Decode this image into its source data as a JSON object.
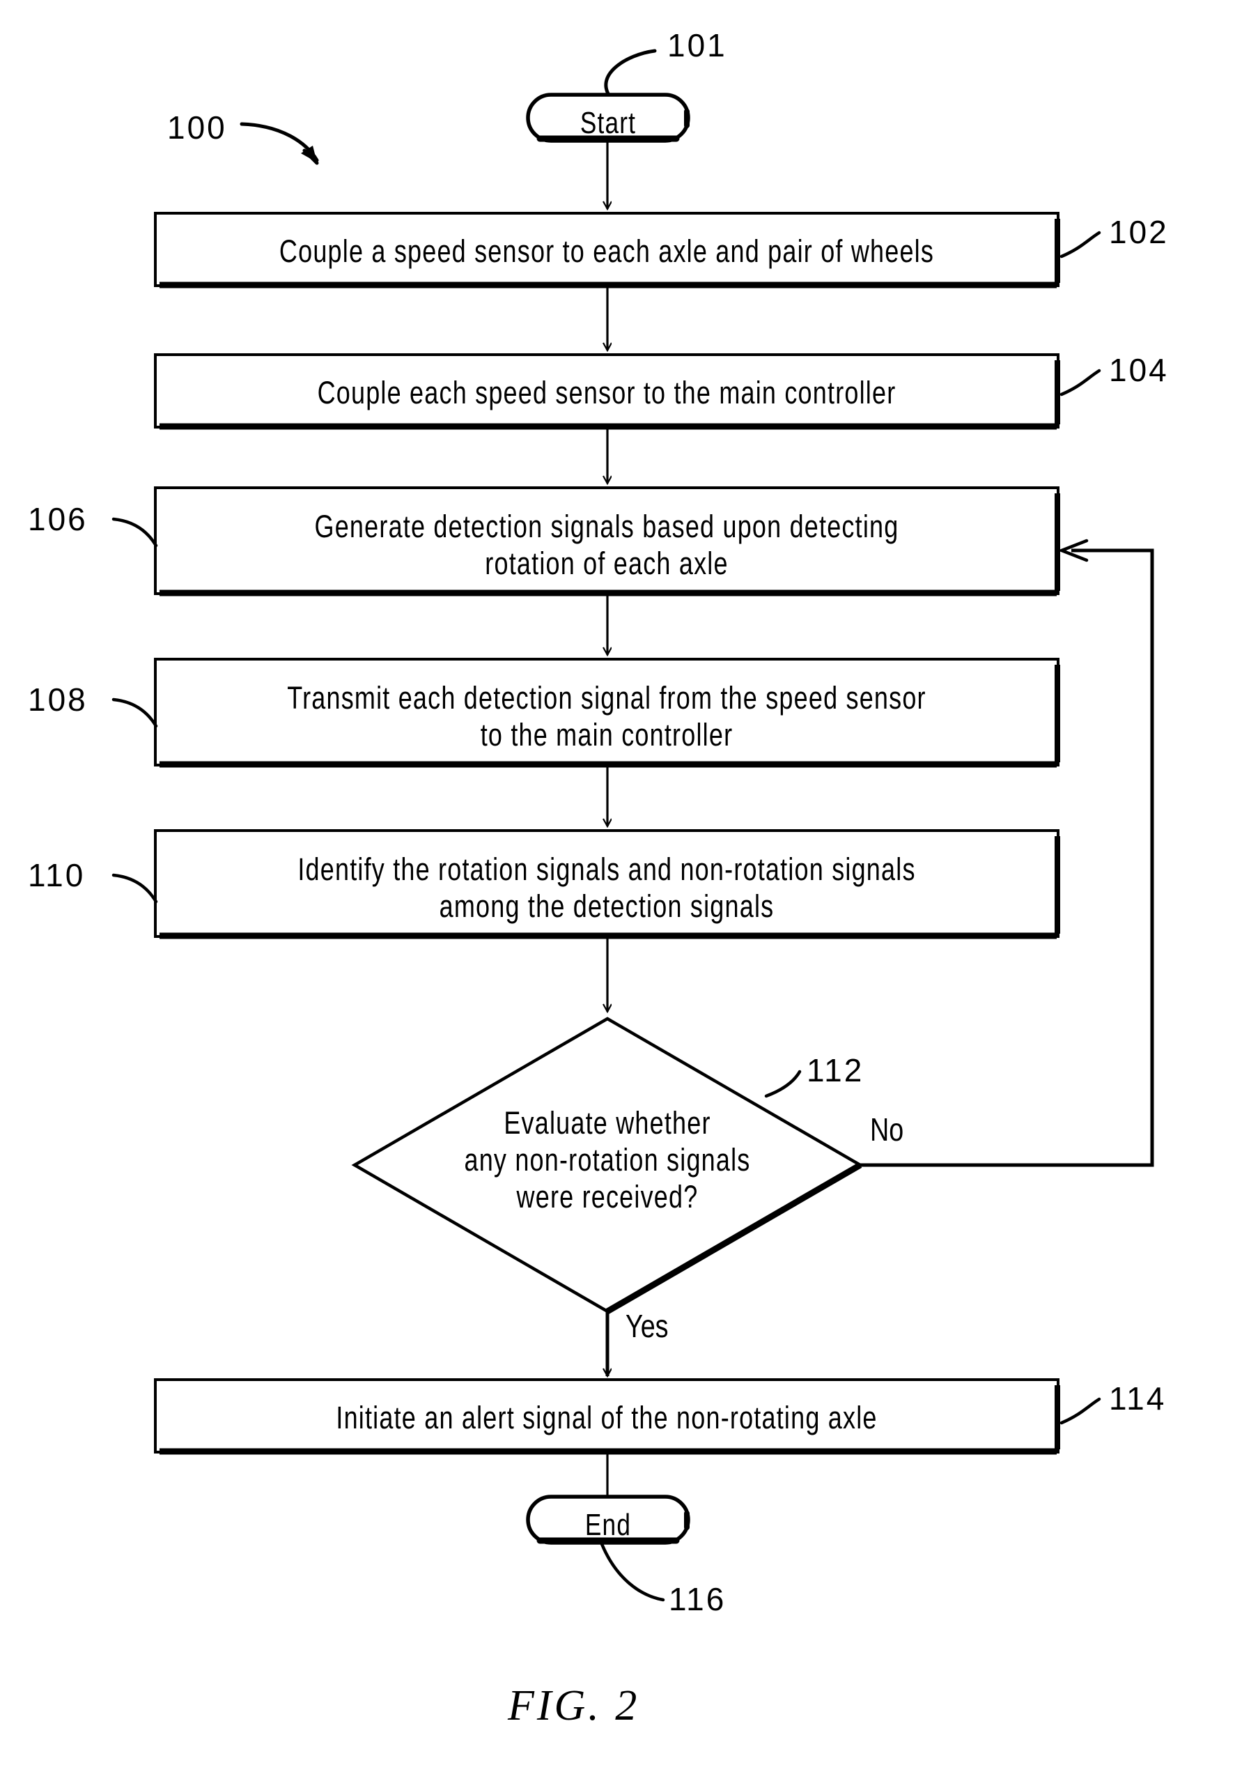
{
  "figure": {
    "caption": "FIG.  2",
    "diagram_ref": "100"
  },
  "nodes": {
    "start": {
      "label": "Start",
      "ref": "101"
    },
    "step102": {
      "label": "Couple a speed sensor to each axle and pair of wheels",
      "ref": "102"
    },
    "step104": {
      "label": "Couple each speed sensor to the main controller",
      "ref": "104"
    },
    "step106": {
      "label": "Generate detection signals based upon detecting\nrotation of each axle",
      "ref": "106"
    },
    "step108": {
      "label": "Transmit each detection signal from the speed sensor\nto the main controller",
      "ref": "108"
    },
    "step110": {
      "label": "Identify the rotation signals and non-rotation signals\namong the detection signals",
      "ref": "110"
    },
    "decision112": {
      "label": "Evaluate whether\nany non-rotation signals\nwere received?",
      "ref": "112"
    },
    "step114": {
      "label": "Initiate an alert signal of the non-rotating axle",
      "ref": "114"
    },
    "end": {
      "label": "End",
      "ref": "116"
    }
  },
  "branches": {
    "no_label": "No",
    "yes_label": "Yes"
  },
  "colors": {
    "ink": "#000000",
    "paper": "#ffffff"
  }
}
